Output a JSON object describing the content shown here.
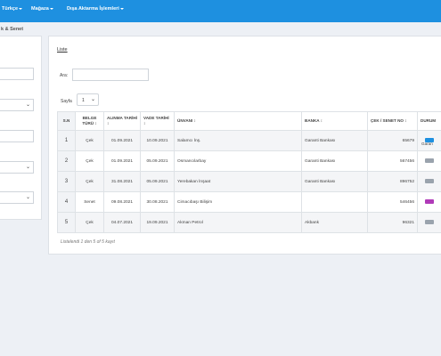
{
  "nav": {
    "items": [
      {
        "label": "Türkçe",
        "x": 2
      },
      {
        "label": "Mağaza",
        "x": 35
      },
      {
        "label": "Dışa Aktarma İşlemleri",
        "x": 75
      }
    ]
  },
  "breadcrumb": "k & Senet",
  "main": {
    "liste_label": "Liste",
    "search_label": "Ara:",
    "search_value": "",
    "page_label": "Sayfa",
    "page_value": "1",
    "footer": "Listelendi 1 den 5 of 5 kayıt"
  },
  "table": {
    "headers": {
      "sn": "S.N",
      "belge_turu": "BELGE TÜRÜ ↕",
      "alinma_tarihi": "ALINMA TARİHİ ↕",
      "vade_tarihi": "VADE TARİHİ ↕",
      "unvani": "ÜNVANI ↕",
      "banka": "BANKA ↕",
      "cek_senet_no": "ÇEK / SENET NO ↕",
      "durum": "DURUM"
    },
    "rows": [
      {
        "sn": "1",
        "belge": "Çek",
        "alinma": "01.09.2021",
        "vade": "10.09.2021",
        "unvan": "Salamcı İnş.",
        "banka": "Garanti Bankası",
        "no": "65679",
        "status_color": "#1e90e0",
        "status_sub": "Garan"
      },
      {
        "sn": "2",
        "belge": "Çek",
        "alinma": "01.09.2021",
        "vade": "05.09.2021",
        "unvan": "Osmancılarbay",
        "banka": "Garanti Bankası",
        "no": "567456",
        "status_color": "#9aa3ad",
        "status_sub": ""
      },
      {
        "sn": "3",
        "belge": "Çek",
        "alinma": "31.08.2021",
        "vade": "05.09.2021",
        "unvan": "Yerebakan İnşaat",
        "banka": "Garanti Bankası",
        "no": "896752",
        "status_color": "#9aa3ad",
        "status_sub": ""
      },
      {
        "sn": "4",
        "belge": "Senet",
        "alinma": "09.08.2021",
        "vade": "30.08.2021",
        "unvan": "Cimacıbaşı Bilişim",
        "banka": "",
        "no": "546456",
        "status_color": "#b03ab8",
        "status_sub": ""
      },
      {
        "sn": "5",
        "belge": "Çek",
        "alinma": "04.07.2021",
        "vade": "19.09.2021",
        "unvan": "Akman Petrol",
        "banka": "Akbank",
        "no": "96321",
        "status_color": "#9aa3ad",
        "status_sub": ""
      }
    ]
  }
}
